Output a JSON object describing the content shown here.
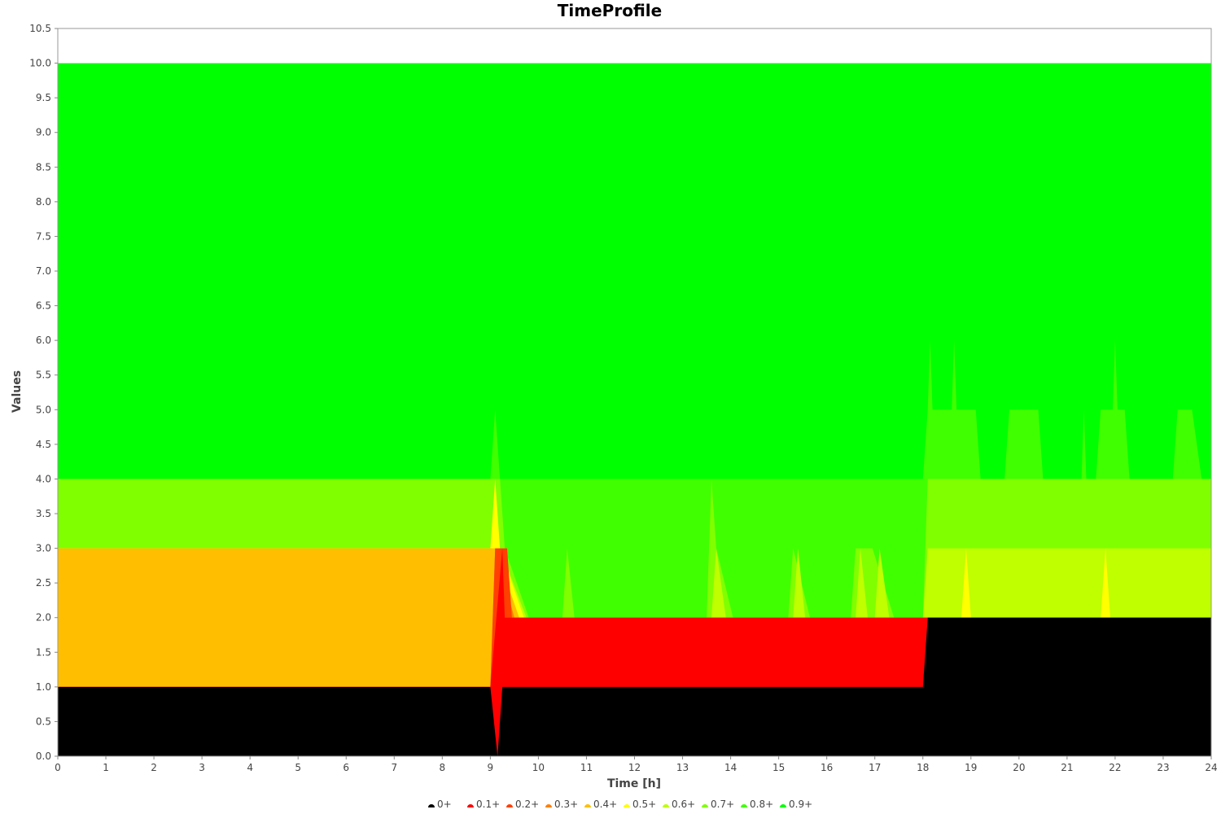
{
  "chart_data": {
    "type": "area",
    "title": "TimeProfile",
    "xlabel": "Time [h]",
    "ylabel": "Values",
    "xlim": [
      0,
      24
    ],
    "ylim": [
      0,
      10.5
    ],
    "x_ticks": [
      "0",
      "1",
      "2",
      "3",
      "4",
      "5",
      "6",
      "7",
      "8",
      "9",
      "10",
      "11",
      "12",
      "13",
      "14",
      "15",
      "16",
      "17",
      "18",
      "19",
      "20",
      "21",
      "22",
      "23",
      "24"
    ],
    "y_ticks": [
      "0.0",
      "0.5",
      "1.0",
      "1.5",
      "2.0",
      "2.5",
      "3.0",
      "3.5",
      "4.0",
      "4.5",
      "5.0",
      "5.5",
      "6.0",
      "6.5",
      "7.0",
      "7.5",
      "8.0",
      "8.5",
      "9.0",
      "9.5",
      "10.0",
      "10.5"
    ],
    "grid": false,
    "legend_position": "bottom",
    "series": [
      {
        "name": "0+",
        "color": "#000000",
        "points": [
          [
            0,
            1
          ],
          [
            9,
            1
          ],
          [
            9.15,
            0
          ],
          [
            9.25,
            1
          ],
          [
            18,
            1
          ],
          [
            18.1,
            2
          ],
          [
            24,
            2
          ]
        ]
      },
      {
        "name": "0.1+",
        "color": "#ff0000",
        "points": [
          [
            0,
            1
          ],
          [
            9,
            1
          ],
          [
            9.25,
            3
          ],
          [
            9.3,
            2
          ],
          [
            18,
            2
          ],
          [
            18.1,
            2
          ],
          [
            24,
            2
          ]
        ]
      },
      {
        "name": "0.2+",
        "color": "#ff4000",
        "points": [
          [
            0,
            1
          ],
          [
            9,
            1
          ],
          [
            9.1,
            3
          ],
          [
            9.35,
            3
          ],
          [
            9.45,
            2
          ],
          [
            18.1,
            2
          ],
          [
            24,
            2
          ]
        ]
      },
      {
        "name": "0.3+",
        "color": "#ff8000",
        "points": [
          [
            0,
            1
          ],
          [
            9,
            1
          ],
          [
            9.1,
            3
          ],
          [
            9.5,
            2
          ],
          [
            18.1,
            2
          ],
          [
            24,
            2
          ]
        ]
      },
      {
        "name": "0.4+",
        "color": "#ffbf00",
        "points": [
          [
            0,
            3
          ],
          [
            9,
            3
          ],
          [
            9.1,
            3
          ],
          [
            9.6,
            2
          ],
          [
            18.1,
            2
          ],
          [
            24,
            2
          ]
        ]
      },
      {
        "name": "0.5+",
        "color": "#ffff00",
        "points": [
          [
            0,
            3
          ],
          [
            9,
            3
          ],
          [
            9.1,
            4
          ],
          [
            9.2,
            3
          ],
          [
            9.7,
            2
          ],
          [
            18.1,
            2
          ],
          [
            18.8,
            2
          ],
          [
            18.9,
            3
          ],
          [
            19,
            2
          ],
          [
            21.7,
            2
          ],
          [
            21.8,
            3
          ],
          [
            21.9,
            2
          ],
          [
            24,
            2
          ]
        ]
      },
      {
        "name": "0.6+",
        "color": "#bfff00",
        "points": [
          [
            0,
            3
          ],
          [
            9,
            3
          ],
          [
            9.2,
            3
          ],
          [
            9.75,
            2
          ],
          [
            13.6,
            2
          ],
          [
            13.7,
            3
          ],
          [
            13.9,
            2
          ],
          [
            15.3,
            2
          ],
          [
            15.4,
            3
          ],
          [
            15.55,
            2
          ],
          [
            16.6,
            2
          ],
          [
            16.7,
            3
          ],
          [
            16.85,
            2
          ],
          [
            17,
            2
          ],
          [
            17.1,
            3
          ],
          [
            17.3,
            2
          ],
          [
            18,
            2
          ],
          [
            18.1,
            3
          ],
          [
            24,
            3
          ]
        ]
      },
      {
        "name": "0.7+",
        "color": "#80ff00",
        "points": [
          [
            0,
            4
          ],
          [
            9,
            4
          ],
          [
            9.2,
            4
          ],
          [
            9.3,
            3
          ],
          [
            9.8,
            2
          ],
          [
            10.5,
            2
          ],
          [
            10.6,
            3
          ],
          [
            10.75,
            2
          ],
          [
            13.5,
            2
          ],
          [
            13.6,
            4
          ],
          [
            13.7,
            3
          ],
          [
            14.05,
            2
          ],
          [
            15.2,
            2
          ],
          [
            15.3,
            3
          ],
          [
            15.65,
            2
          ],
          [
            16.5,
            2
          ],
          [
            16.6,
            3
          ],
          [
            16.95,
            3
          ],
          [
            17.4,
            2
          ],
          [
            18,
            2
          ],
          [
            18.1,
            4
          ],
          [
            24,
            4
          ]
        ]
      },
      {
        "name": "0.8+",
        "color": "#40ff00",
        "points": [
          [
            0,
            4
          ],
          [
            9,
            4
          ],
          [
            9.1,
            5
          ],
          [
            9.2,
            4
          ],
          [
            18,
            4
          ],
          [
            18.1,
            5
          ],
          [
            18.15,
            6
          ],
          [
            18.2,
            5
          ],
          [
            18.6,
            5
          ],
          [
            18.65,
            6
          ],
          [
            18.7,
            5
          ],
          [
            19.1,
            5
          ],
          [
            19.2,
            4
          ],
          [
            19.7,
            4
          ],
          [
            19.8,
            5
          ],
          [
            20.4,
            5
          ],
          [
            20.5,
            4
          ],
          [
            21.3,
            4
          ],
          [
            21.35,
            5
          ],
          [
            21.4,
            4
          ],
          [
            21.6,
            4
          ],
          [
            21.7,
            5
          ],
          [
            21.95,
            5
          ],
          [
            22,
            6
          ],
          [
            22.05,
            5
          ],
          [
            22.2,
            5
          ],
          [
            22.3,
            4
          ],
          [
            23.2,
            4
          ],
          [
            23.3,
            5
          ],
          [
            23.6,
            5
          ],
          [
            23.8,
            4
          ],
          [
            24,
            4
          ]
        ]
      },
      {
        "name": "0.9+",
        "color": "#00ff00",
        "points": [
          [
            0,
            10
          ],
          [
            24,
            10
          ]
        ]
      }
    ]
  }
}
